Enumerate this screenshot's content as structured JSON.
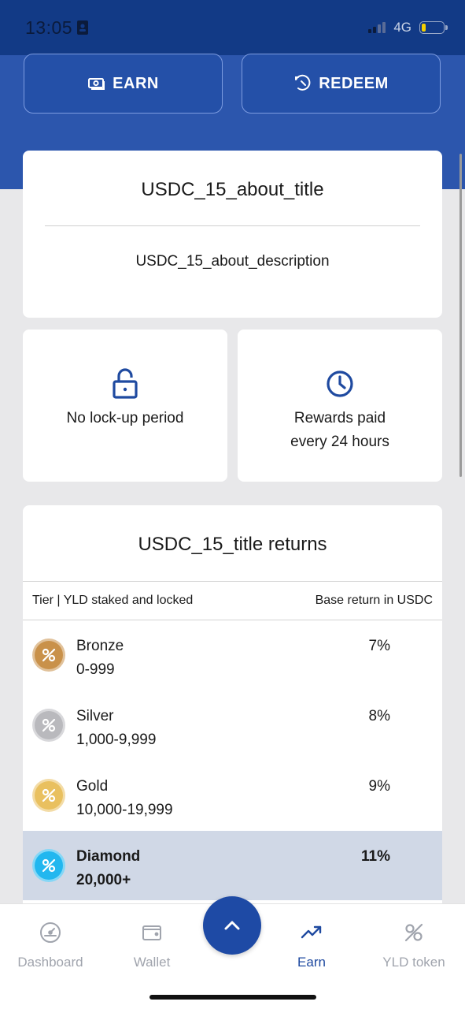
{
  "status_bar": {
    "time": "13:05",
    "network": "4G",
    "battery_level": 0.2,
    "colors": {
      "bar": "#123a86",
      "battery": "#f5d000"
    }
  },
  "actions": {
    "earn_label": "EARN",
    "redeem_label": "REDEEM"
  },
  "about": {
    "title": "USDC_15_about_title",
    "description": "USDC_15_about_description"
  },
  "features": [
    {
      "icon": "lock-open-icon",
      "text": "No lock-up period"
    },
    {
      "icon": "clock-icon",
      "text": "Rewards paid\nevery 24 hours"
    }
  ],
  "returns": {
    "title": "USDC_15_title returns",
    "col_tier": "Tier | YLD staked and locked",
    "col_return": "Base return in USDC",
    "tiers": [
      {
        "name": "Bronze",
        "range": "0-999",
        "return": "7%",
        "color": "#c9914a"
      },
      {
        "name": "Silver",
        "range": "1,000-9,999",
        "return": "8%",
        "color": "#b9b9bd"
      },
      {
        "name": "Gold",
        "range": "10,000-19,999",
        "return": "9%",
        "color": "#e9c05f"
      },
      {
        "name": "Diamond",
        "range": "20,000+",
        "return": "11%",
        "color": "#22b7ef"
      }
    ]
  },
  "nav": {
    "items": [
      {
        "label": "Dashboard",
        "icon": "gauge-icon"
      },
      {
        "label": "Wallet",
        "icon": "wallet-icon"
      },
      {
        "label": "Earn",
        "icon": "trending-up-icon"
      },
      {
        "label": "YLD token",
        "icon": "yld-token-icon"
      }
    ],
    "active": "Earn",
    "colors": {
      "active": "#1f4aa0",
      "inactive": "#a0a4ad",
      "fab": "#1e4aa5"
    }
  }
}
